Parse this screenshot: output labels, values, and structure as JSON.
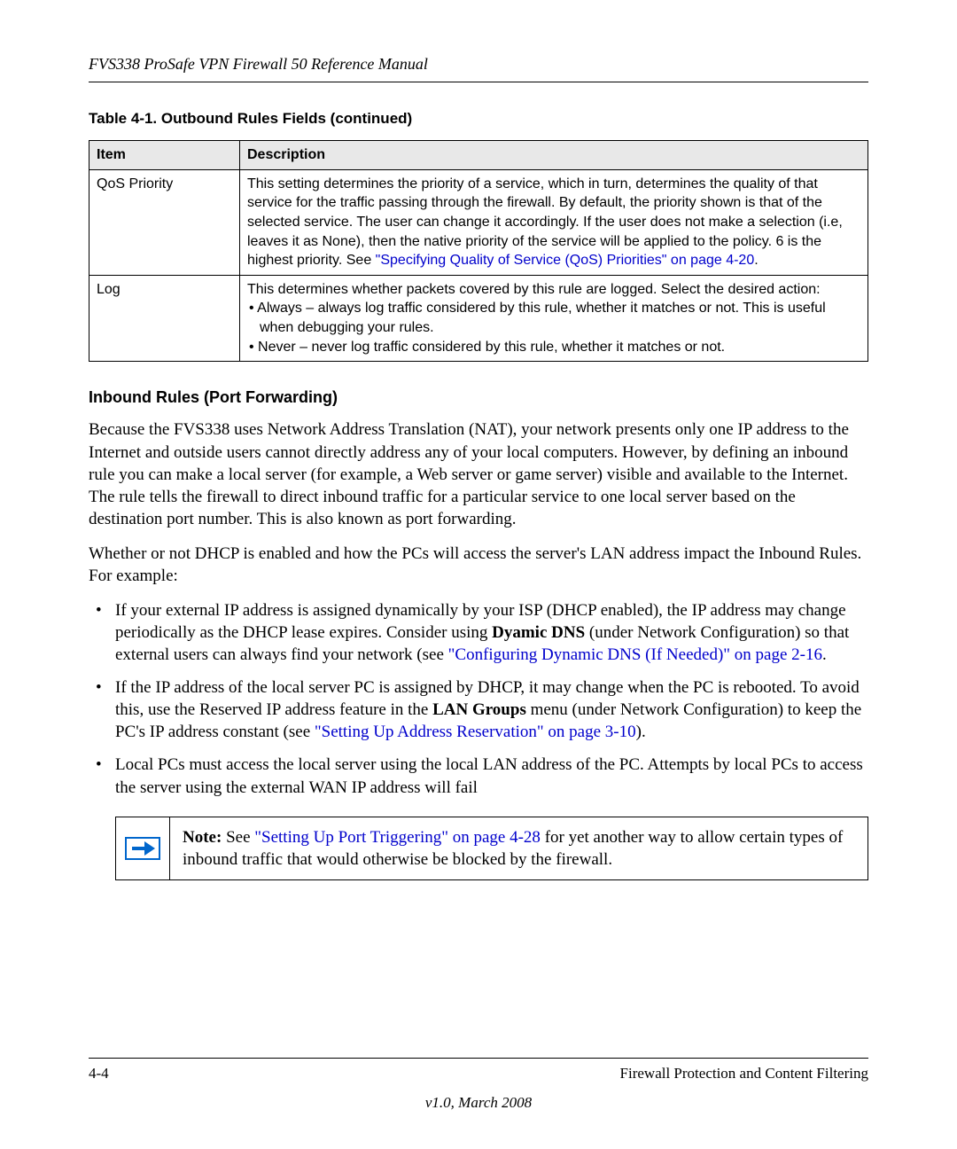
{
  "header": {
    "title": "FVS338 ProSafe VPN Firewall 50 Reference Manual"
  },
  "table": {
    "caption": "Table 4-1.   Outbound Rules Fields (continued)",
    "headers": {
      "item": "Item",
      "description": "Description"
    },
    "rows": [
      {
        "item": "QoS Priority",
        "desc_before": "This setting determines the priority of a service, which in turn, determines the quality of that service for the traffic passing through the firewall. By default, the priority shown is that of the selected service. The user can change it accordingly. If the user does not make a selection (i.e, leaves it as None), then the native priority of the service will be applied to the policy. 6 is the highest priority. See ",
        "desc_link": "\"Specifying Quality of Service (QoS) Priorities\" on page 4-20",
        "desc_after": "."
      },
      {
        "item": "Log",
        "desc_intro": "This determines whether packets covered by this rule are logged. Select the desired action:",
        "bullets": [
          "Always – always log traffic considered by this rule, whether it matches or not. This is useful when debugging your rules.",
          "Never – never log traffic considered by this rule, whether it matches or not."
        ]
      }
    ]
  },
  "section": {
    "heading": "Inbound Rules (Port Forwarding)",
    "para1": "Because the FVS338 uses Network Address Translation (NAT), your network presents only one IP address to the Internet and outside users cannot directly address any of your local computers. However, by defining an inbound rule you can make a local server (for example, a Web server or game server) visible and available to the Internet. The rule tells the firewall to direct inbound traffic for a particular service to one local server based on the destination port number. This is also known as port forwarding.",
    "para2": "Whether or not DHCP is enabled and how the PCs will access the server's LAN address impact the Inbound Rules. For example:",
    "bullets": [
      {
        "pre": "If your external IP address is assigned dynamically by your ISP (DHCP enabled), the IP address may change periodically as the DHCP lease expires. Consider using ",
        "bold1": "Dyamic DNS",
        "mid": " (under Network Configuration) so that external users can always find your network (see ",
        "link": "\"Configuring Dynamic DNS (If Needed)\" on page 2-16",
        "post": "."
      },
      {
        "pre": "If the IP address of the local server PC is assigned by DHCP, it may change when the PC is rebooted. To avoid this, use the Reserved IP address feature in the ",
        "bold1": "LAN Groups",
        "mid": " menu (under Network Configuration) to keep the PC's IP address constant (see ",
        "link": "\"Setting Up Address Reservation\" on page 3-10",
        "post": ")."
      },
      {
        "pre": "Local PCs must access the local server using the local LAN address of the PC. Attempts by local PCs to access the server using the external WAN IP address will fail",
        "bold1": "",
        "mid": "",
        "link": "",
        "post": ""
      }
    ],
    "note": {
      "label": "Note: ",
      "pre": "See ",
      "link": "\"Setting Up Port Triggering\" on page 4-28",
      "post": " for yet another way to allow certain types of inbound traffic that would otherwise be blocked by the firewall."
    }
  },
  "footer": {
    "page": "4-4",
    "chapter": "Firewall Protection and Content Filtering",
    "version": "v1.0, March 2008"
  }
}
